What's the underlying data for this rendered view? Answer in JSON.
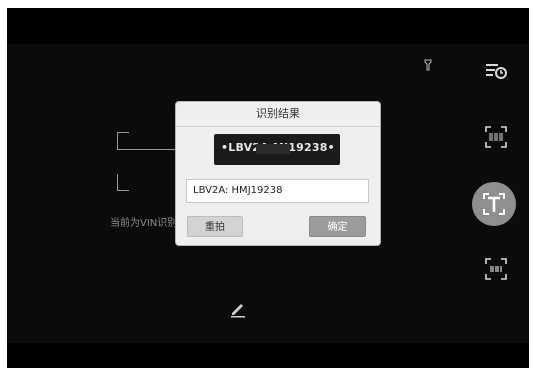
{
  "dialog": {
    "title": "识别结果",
    "plate_text": "•LBV2A          MJ19238•",
    "vin_value": "LBV2A:   HMJ19238",
    "retake_label": "重拍",
    "ok_label": "确定"
  },
  "hint": {
    "text": "当前为VIN识别"
  },
  "icons": {
    "flash": "flashlight-icon",
    "history": "history-icon",
    "vin_scan": "barcode-scan-icon",
    "text_mode": "text-recognition-icon",
    "barcode_mode": "barcode-frame-icon",
    "edit": "pencil-icon"
  }
}
